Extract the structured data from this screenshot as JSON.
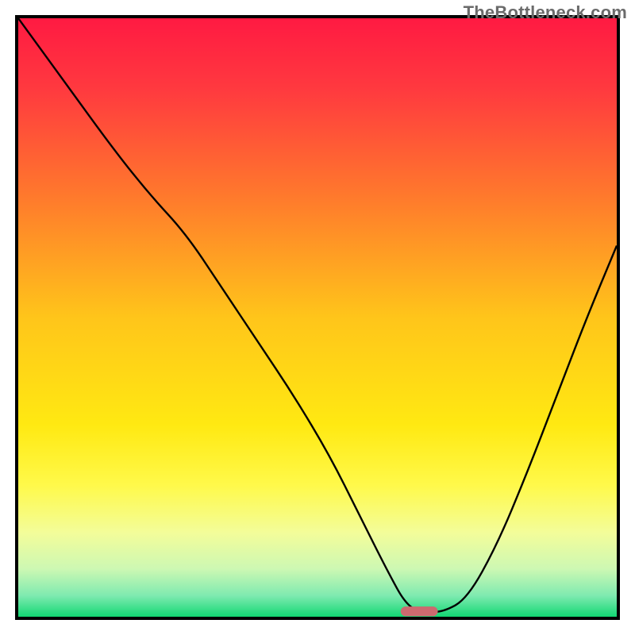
{
  "watermark": "TheBottleneck.com",
  "chart_data": {
    "type": "line",
    "title": "",
    "xlabel": "",
    "ylabel": "",
    "xlim": [
      0,
      100
    ],
    "ylim": [
      0,
      100
    ],
    "axes_visible": false,
    "grid": false,
    "background_gradient_stops": [
      {
        "offset": 0.0,
        "color": "#ff1a42"
      },
      {
        "offset": 0.12,
        "color": "#ff3a3f"
      },
      {
        "offset": 0.3,
        "color": "#ff7a2c"
      },
      {
        "offset": 0.5,
        "color": "#ffc51a"
      },
      {
        "offset": 0.68,
        "color": "#ffe912"
      },
      {
        "offset": 0.78,
        "color": "#fff94a"
      },
      {
        "offset": 0.86,
        "color": "#f3fd9a"
      },
      {
        "offset": 0.92,
        "color": "#cdf8b3"
      },
      {
        "offset": 0.965,
        "color": "#7eeab0"
      },
      {
        "offset": 1.0,
        "color": "#12d873"
      }
    ],
    "series": [
      {
        "name": "bottleneck-curve",
        "x": [
          0,
          8,
          16,
          22,
          28,
          34,
          40,
          46,
          52,
          57,
          61.5,
          65,
          68,
          71,
          75,
          80,
          85,
          90,
          95,
          100
        ],
        "y": [
          100,
          89,
          78,
          70.5,
          64,
          55,
          46,
          37,
          27,
          17,
          8,
          1.6,
          0.8,
          0.8,
          3,
          12,
          24,
          37,
          50,
          62
        ]
      }
    ],
    "marker": {
      "name": "optimal-range-marker",
      "x_center": 67,
      "y": 0.9,
      "width": 6.2,
      "height": 1.6,
      "radius": 0.8,
      "color": "#cc6a6f"
    },
    "frame": {
      "stroke": "#000000",
      "width": 4,
      "inset": 23
    }
  }
}
